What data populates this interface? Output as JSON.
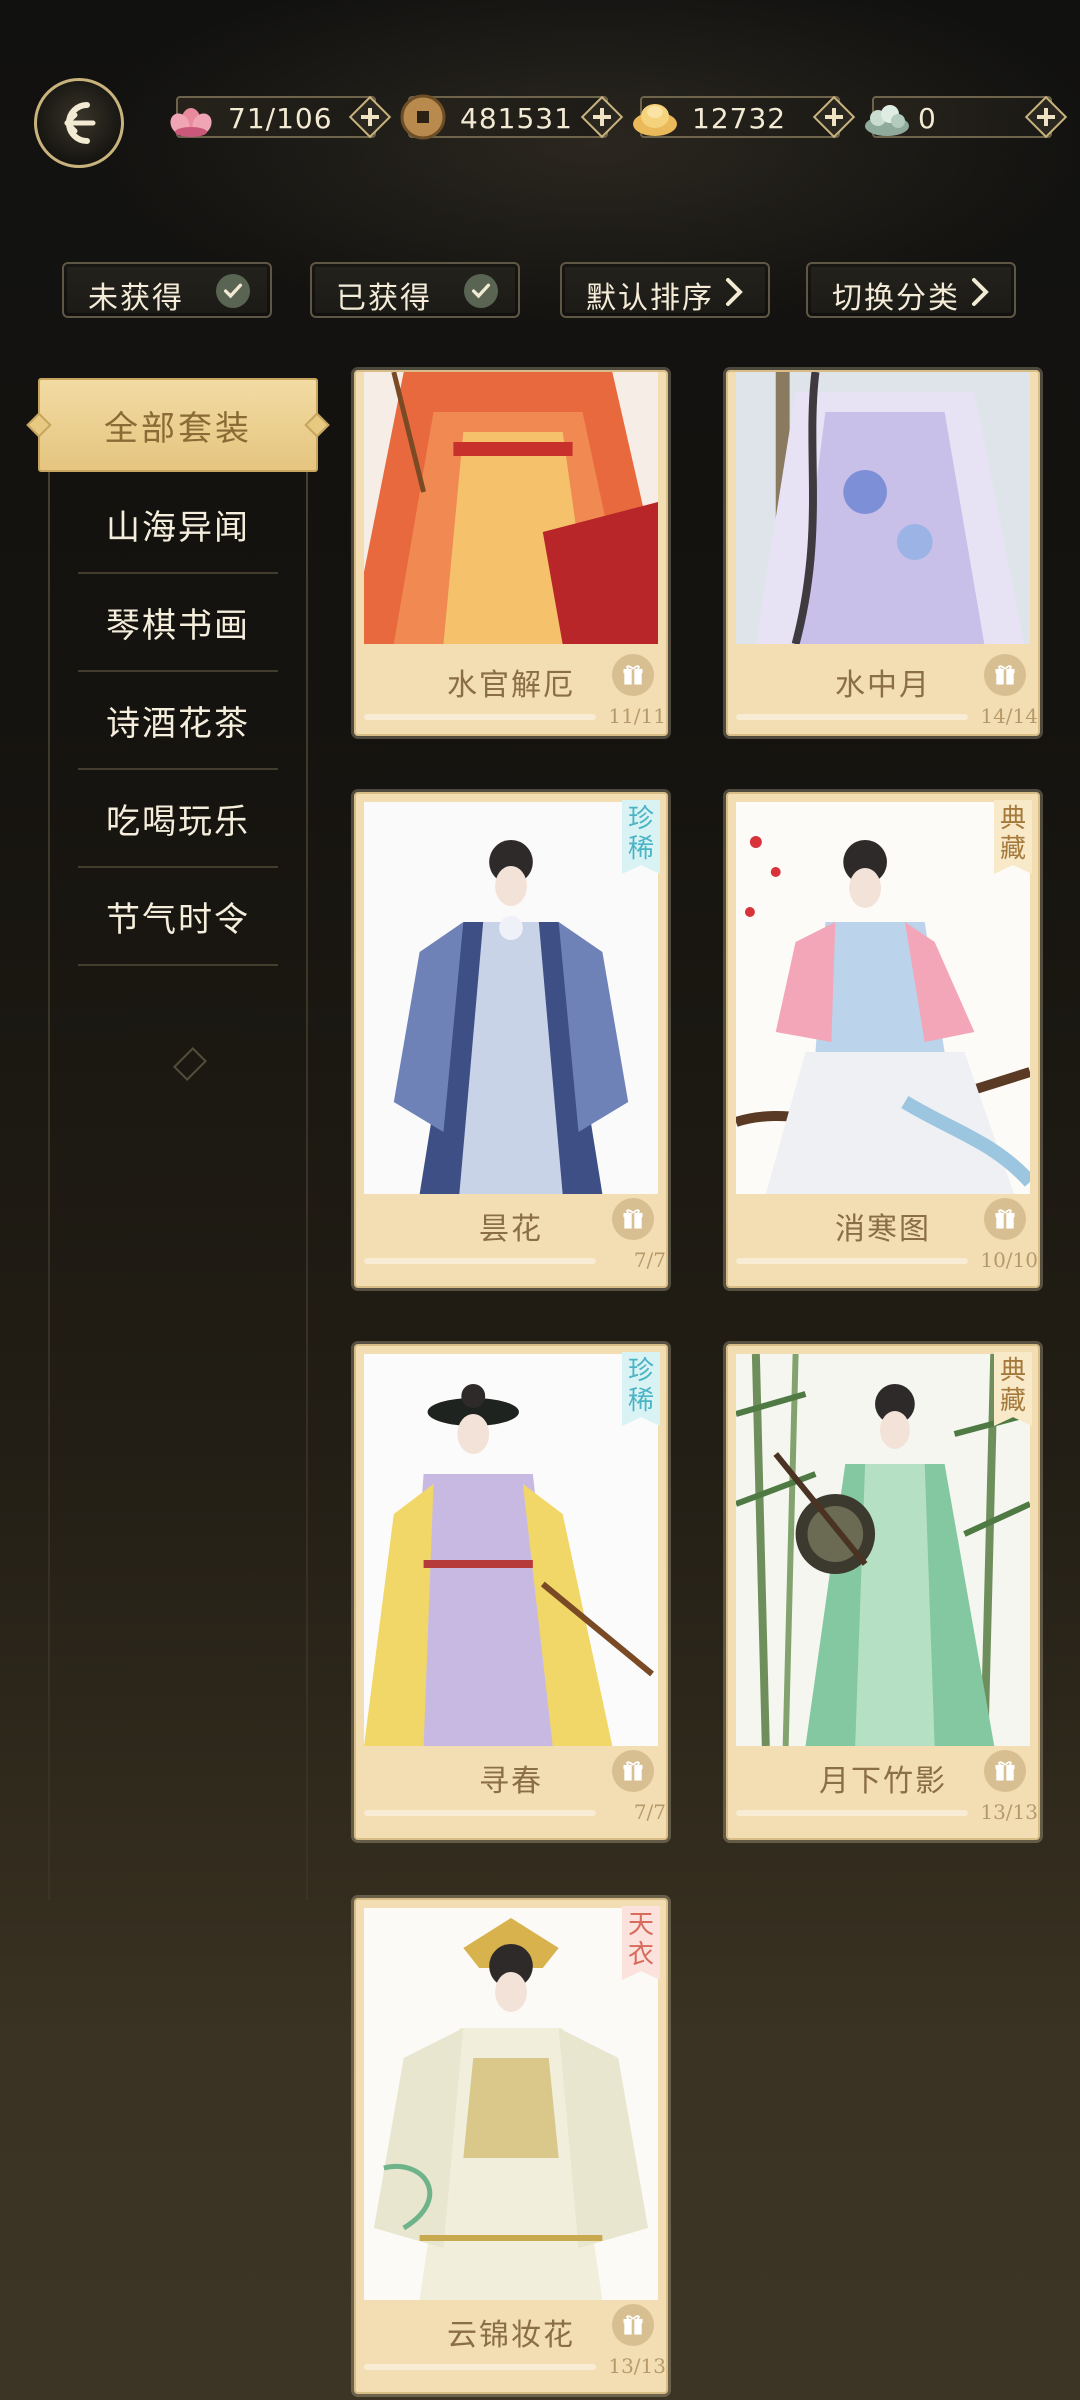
{
  "resources": [
    {
      "icon": "lotus-icon",
      "value": "71/106"
    },
    {
      "icon": "copper-coin-icon",
      "value": "481531"
    },
    {
      "icon": "gold-ingot-icon",
      "value": "12732"
    },
    {
      "icon": "jade-icon",
      "value": "0"
    }
  ],
  "filters": {
    "unobtained": "未获得",
    "obtained": "已获得",
    "sort": "默认排序",
    "switch": "切换分类"
  },
  "sidebar": {
    "active": "全部套装",
    "items": [
      "山海异闻",
      "琴棋书画",
      "诗酒花茶",
      "吃喝玩乐",
      "节气时令"
    ]
  },
  "cards": [
    {
      "name": "水官解厄",
      "count": "11/11",
      "progress": 1.0,
      "rarity": ""
    },
    {
      "name": "水中月",
      "count": "14/14",
      "progress": 1.0,
      "rarity": ""
    },
    {
      "name": "昙花",
      "count": "7/7",
      "progress": 1.0,
      "rarity": "珍稀"
    },
    {
      "name": "消寒图",
      "count": "10/10",
      "progress": 1.0,
      "rarity": "典藏"
    },
    {
      "name": "寻春",
      "count": "7/7",
      "progress": 1.0,
      "rarity": "珍稀"
    },
    {
      "name": "月下竹影",
      "count": "13/13",
      "progress": 1.0,
      "rarity": "典藏"
    },
    {
      "name": "云锦妆花",
      "count": "13/13",
      "progress": 1.0,
      "rarity": "天衣"
    }
  ]
}
